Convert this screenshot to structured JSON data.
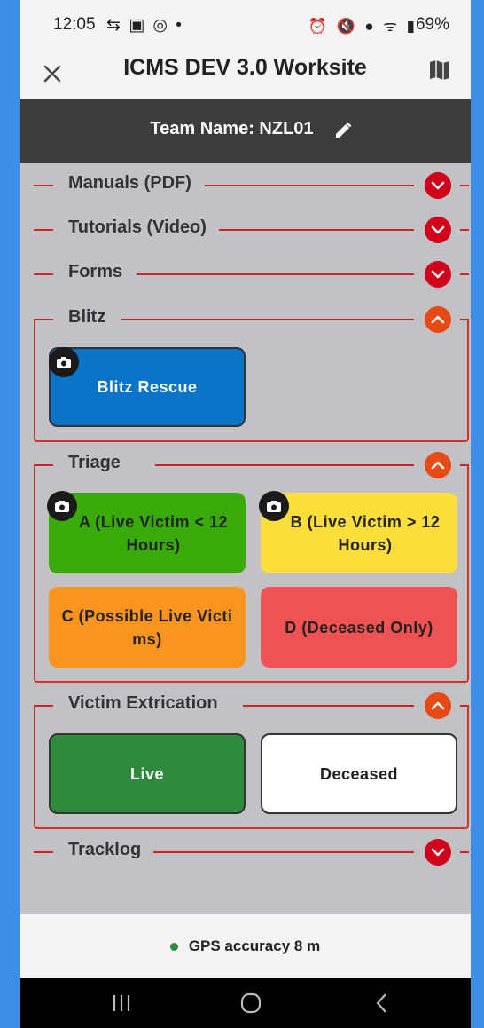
{
  "status_bar": {
    "time": "12:05",
    "left_icons": "⇆ ▣ ◎ •",
    "right_icons": "⏰ 🔇 ● ᯤ ▮",
    "battery": "69%"
  },
  "app_bar": {
    "title": "ICMS DEV 3.0 Worksite",
    "close_icon": "close-icon",
    "map_icon": "map-icon"
  },
  "team": {
    "label": "Team Name: NZL01",
    "edit_icon": "pencil-icon"
  },
  "sections": {
    "manuals": {
      "label": "Manuals (PDF)",
      "state": "collapsed"
    },
    "tutorials": {
      "label": "Tutorials (Video)",
      "state": "collapsed"
    },
    "forms": {
      "label": "Forms",
      "state": "collapsed"
    },
    "blitz": {
      "label": "Blitz",
      "state": "expanded",
      "buttons": [
        {
          "label": "Blitz Rescue",
          "color": "#0a74c9",
          "camera": true
        }
      ]
    },
    "triage": {
      "label": "Triage",
      "state": "expanded",
      "buttons": [
        {
          "label": "A (Live Victim < 12 Hours)",
          "color": "#3aaa0a",
          "camera": true
        },
        {
          "label": "B (Live Victim > 12 Hours)",
          "color": "#fbde3a",
          "camera": true
        },
        {
          "label": "C (Possible Live Victi ms)",
          "color": "#f9941f",
          "camera": false
        },
        {
          "label": "D (Deceased Only)",
          "color": "#ee5252",
          "camera": false
        }
      ]
    },
    "extrication": {
      "label": "Victim Extrication",
      "state": "expanded",
      "buttons": [
        {
          "label": "Live",
          "color": "#2e8b3d"
        },
        {
          "label": "Deceased",
          "color": "#ffffff"
        }
      ]
    },
    "tracklog": {
      "label": "Tracklog",
      "state": "collapsed"
    }
  },
  "footer": {
    "gps_text": "GPS accuracy 8 m",
    "gps_dot_color": "#2e8b3d"
  },
  "nav": {
    "recents_icon": "recents-icon",
    "home_icon": "home-icon",
    "back_icon": "back-icon"
  },
  "colors": {
    "accent_red": "#c62828",
    "toggle_collapsed": "#d0021b",
    "toggle_expanded": "#e84a16",
    "team_bar": "#3c3c3c",
    "page_bg": "#c2c2c4"
  }
}
